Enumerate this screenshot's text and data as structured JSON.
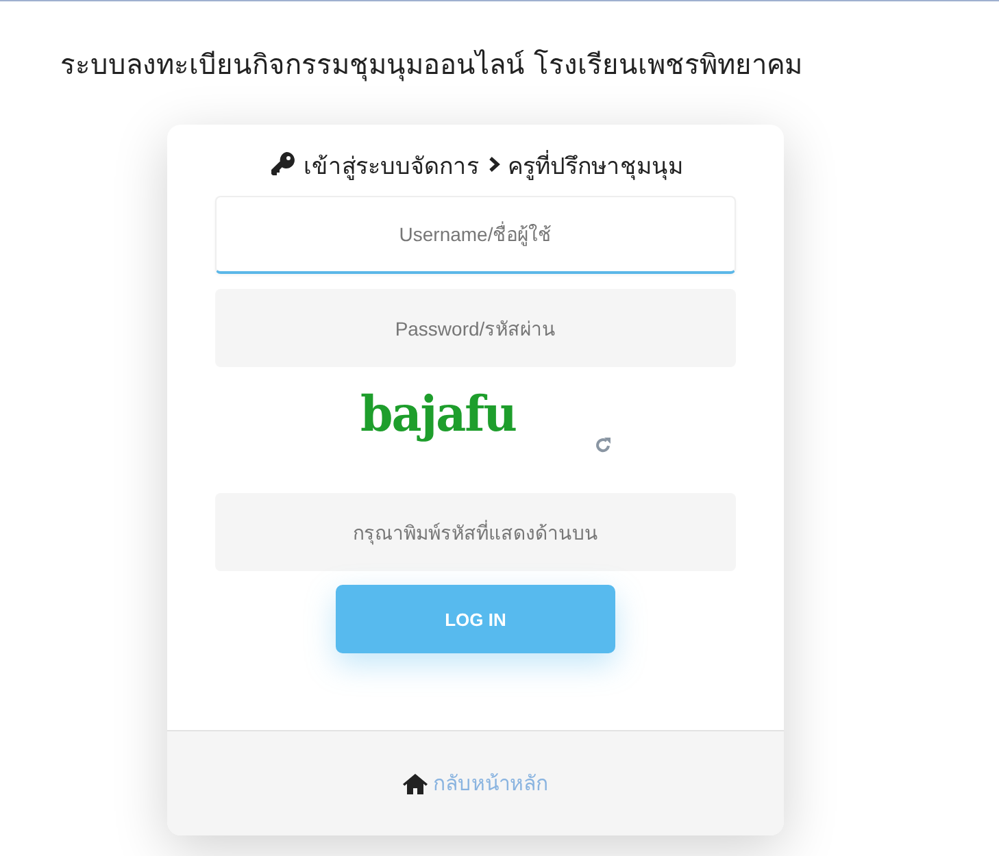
{
  "page_title": "ระบบลงทะเบียนกิจกรรมชุมนุมออนไลน์ โรงเรียนเพชรพิทยาคม",
  "login_card": {
    "breadcrumb": [
      {
        "label": "เข้าสู่ระบบจัดการ"
      },
      {
        "label": "ครูที่ปรึกษาชุมนุม"
      }
    ],
    "fields": [
      {
        "placeholder": "Username/ชื่อผู้ใช้",
        "focused": true
      },
      {
        "placeholder": "Password/รหัสผ่าน",
        "focused": false
      }
    ],
    "captcha": {
      "text": "bajafu"
    },
    "captcha_field": {
      "placeholder": "กรุณาพิมพ์รหัสที่แสดงด้านบน",
      "focused": false
    },
    "login_button": "LOG IN",
    "footer_link": "กลับหน้าหลัก"
  }
}
